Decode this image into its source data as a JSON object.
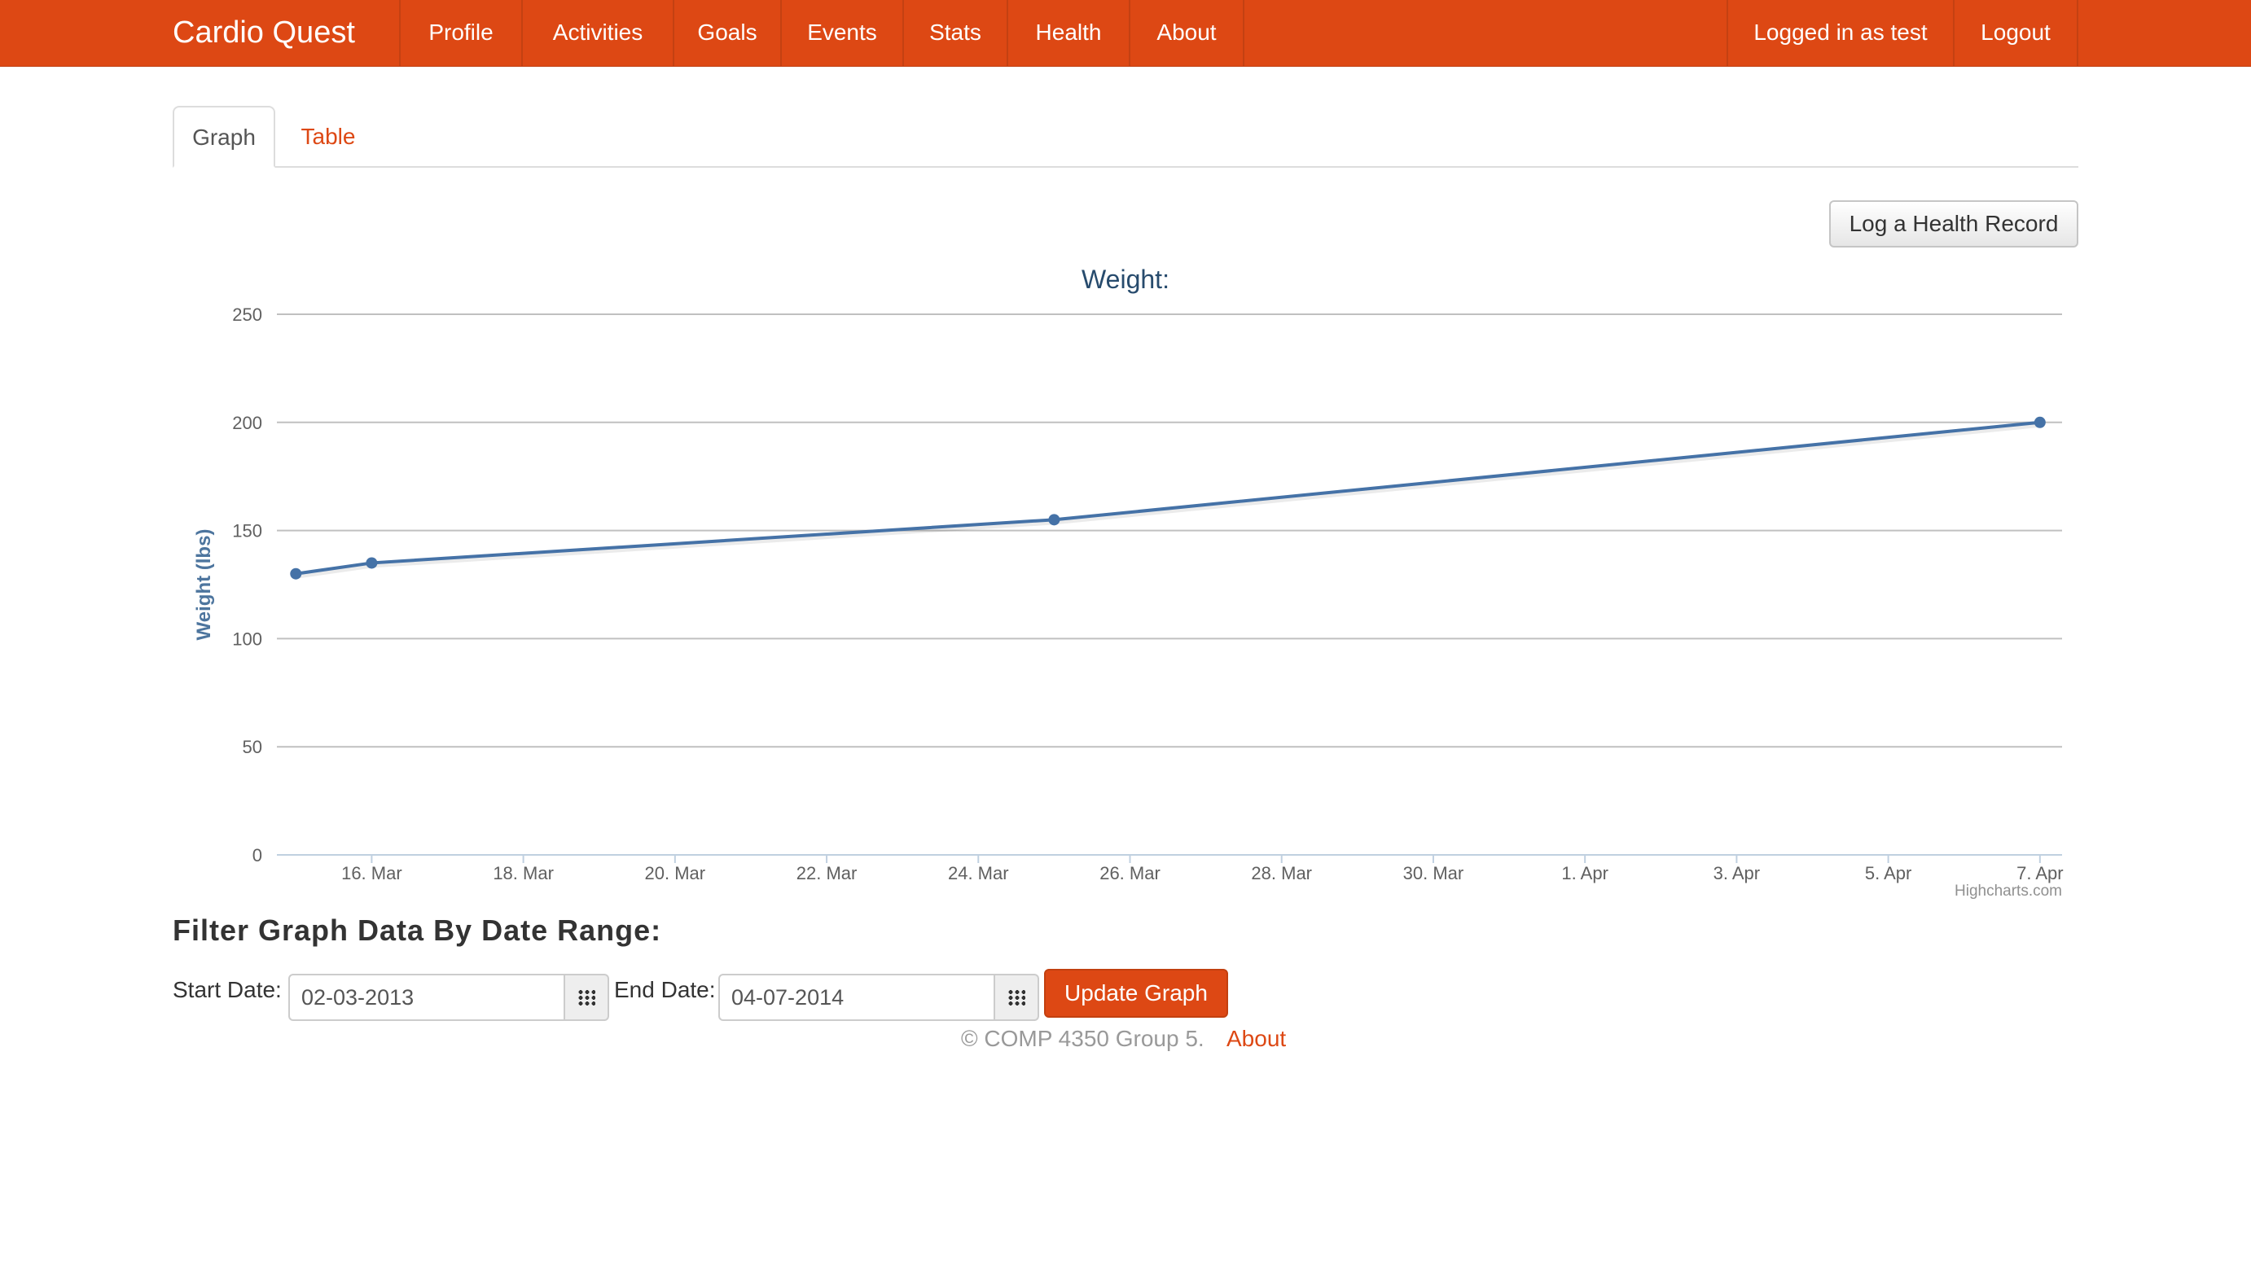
{
  "app": {
    "brand": "Cardio Quest"
  },
  "nav": {
    "items": [
      "Profile",
      "Activities",
      "Goals",
      "Events",
      "Stats",
      "Health",
      "About"
    ],
    "user_status": "Logged in as test",
    "logout": "Logout"
  },
  "tabs": {
    "graph": "Graph",
    "table": "Table"
  },
  "buttons": {
    "log_record": "Log a Health Record",
    "update_graph": "Update Graph"
  },
  "filter": {
    "title": "Filter Graph Data By Date Range:",
    "start_label": "Start Date:",
    "start_value": "02-03-2013",
    "end_label": "End Date:",
    "end_value": "04-07-2014"
  },
  "footer": {
    "copyright": "© COMP 4350 Group 5.",
    "about": "About"
  },
  "colors": {
    "brand": "#dd4814",
    "series": "#4572a7"
  },
  "chart_data": {
    "type": "line",
    "title": "Weight:",
    "ylabel": "Weight (lbs)",
    "xlabel": "",
    "ylim": [
      0,
      250
    ],
    "yticks": [
      0,
      50,
      100,
      150,
      200,
      250
    ],
    "xlim": [
      "2014-03-14T18:00",
      "2014-04-07T07:00"
    ],
    "xticks": [
      {
        "date": "2014-03-16",
        "label": "16. Mar"
      },
      {
        "date": "2014-03-18",
        "label": "18. Mar"
      },
      {
        "date": "2014-03-20",
        "label": "20. Mar"
      },
      {
        "date": "2014-03-22",
        "label": "22. Mar"
      },
      {
        "date": "2014-03-24",
        "label": "24. Mar"
      },
      {
        "date": "2014-03-26",
        "label": "26. Mar"
      },
      {
        "date": "2014-03-28",
        "label": "28. Mar"
      },
      {
        "date": "2014-03-30",
        "label": "30. Mar"
      },
      {
        "date": "2014-04-01",
        "label": "1. Apr"
      },
      {
        "date": "2014-04-03",
        "label": "3. Apr"
      },
      {
        "date": "2014-04-05",
        "label": "5. Apr"
      },
      {
        "date": "2014-04-07",
        "label": "7. Apr"
      }
    ],
    "series": [
      {
        "points": [
          {
            "x": "2014-03-15",
            "y": 130
          },
          {
            "x": "2014-03-16",
            "y": 135
          },
          {
            "x": "2014-03-25",
            "y": 155
          },
          {
            "x": "2014-04-07",
            "y": 200
          }
        ]
      }
    ],
    "credit": "Highcharts.com",
    "grid": true,
    "legend": "none"
  }
}
